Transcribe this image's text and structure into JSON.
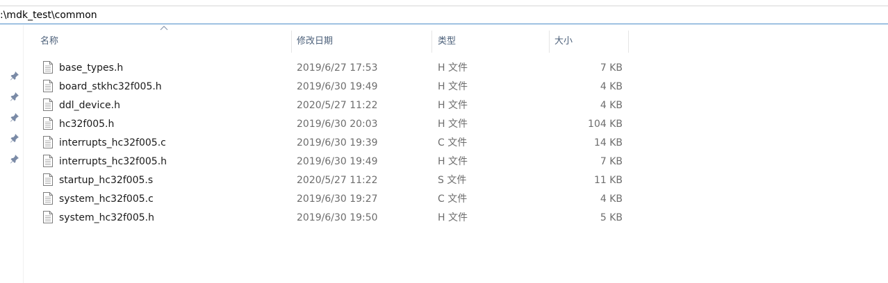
{
  "address": {
    "path": ":\\mdk_test\\common"
  },
  "nav_pane": {
    "pins": [
      "pin-icon",
      "pin-icon",
      "pin-icon",
      "pin-icon",
      "pin-icon"
    ]
  },
  "columns": {
    "name": "名称",
    "date": "修改日期",
    "type": "类型",
    "size": "大小",
    "sort_icon": "chevron-up-icon"
  },
  "files": [
    {
      "name": "base_types.h",
      "date": "2019/6/27 17:53",
      "type": "H 文件",
      "size": "7 KB",
      "icon": "file-icon"
    },
    {
      "name": "board_stkhc32f005.h",
      "date": "2019/6/30 19:49",
      "type": "H 文件",
      "size": "4 KB",
      "icon": "file-icon"
    },
    {
      "name": "ddl_device.h",
      "date": "2020/5/27 11:22",
      "type": "H 文件",
      "size": "4 KB",
      "icon": "file-icon"
    },
    {
      "name": "hc32f005.h",
      "date": "2019/6/30 20:03",
      "type": "H 文件",
      "size": "104 KB",
      "icon": "file-icon"
    },
    {
      "name": "interrupts_hc32f005.c",
      "date": "2019/6/30 19:39",
      "type": "C 文件",
      "size": "14 KB",
      "icon": "file-icon"
    },
    {
      "name": "interrupts_hc32f005.h",
      "date": "2019/6/30 19:49",
      "type": "H 文件",
      "size": "7 KB",
      "icon": "file-icon"
    },
    {
      "name": "startup_hc32f005.s",
      "date": "2020/5/27 11:22",
      "type": "S 文件",
      "size": "11 KB",
      "icon": "file-icon"
    },
    {
      "name": "system_hc32f005.c",
      "date": "2019/6/30 19:27",
      "type": "C 文件",
      "size": "4 KB",
      "icon": "file-icon"
    },
    {
      "name": "system_hc32f005.h",
      "date": "2019/6/30 19:50",
      "type": "H 文件",
      "size": "5 KB",
      "icon": "file-icon"
    }
  ]
}
